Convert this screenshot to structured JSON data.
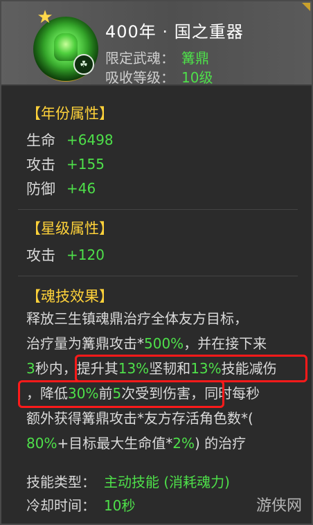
{
  "header": {
    "title": "400年 · 国之重器",
    "limited_label": "限定武魂：",
    "limited_value": "篝鼎",
    "absorb_label": "吸收等级：",
    "absorb_value": "10级",
    "badge_glyph": "☘"
  },
  "year_section": {
    "title": "【年份属性】",
    "stats": [
      {
        "name": "生命",
        "value": "+6498"
      },
      {
        "name": "攻击",
        "value": "+155"
      },
      {
        "name": "防御",
        "value": "+46"
      }
    ]
  },
  "star_section": {
    "title": "【星级属性】",
    "stats": [
      {
        "name": "攻击",
        "value": "+120"
      }
    ]
  },
  "skill_section": {
    "title": "【魂技效果】",
    "line1": "释放三生镇魂鼎治疗全体友方目标，",
    "line2_a": "治疗量为篝鼎攻击*",
    "line2_b": "500%",
    "line2_c": "，并在接下来",
    "line3_a": "3",
    "line3_b": "秒内，",
    "line3_c": "提升其",
    "line3_d": "13%",
    "line3_e": "坚韧和",
    "line3_f": "13%",
    "line3_g": "技能减伤",
    "line4_a": "，降低",
    "line4_b": "30%",
    "line4_c": "前",
    "line4_d": "5",
    "line4_e": "次受到伤害，",
    "line4_f": "同时每秒",
    "line5": "额外获得篝鼎攻击*友方存活角色数*(",
    "line6_a": "80%",
    "line6_b": "+目标最大生命值*",
    "line6_c": "2%",
    "line6_d": ") 的治疗"
  },
  "footer": {
    "type_label": "技能类型：",
    "type_value": "主动技能 (消耗魂力)",
    "cooldown_label": "冷却时间：",
    "cooldown_value": "10秒"
  },
  "watermark": "游侠网",
  "colors": {
    "accent_yellow": "#ffd23a",
    "accent_green": "#4ee04a",
    "highlight_red": "#ff1a1a"
  }
}
